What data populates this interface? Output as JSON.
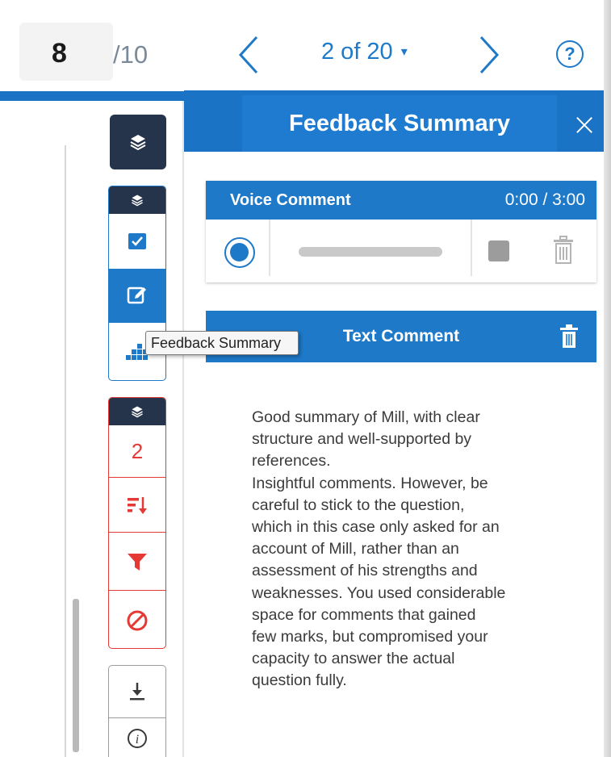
{
  "grade": {
    "score": "8",
    "max": "/10"
  },
  "navigation": {
    "prev_icon": "chevron-left-icon",
    "next_icon": "chevron-right-icon",
    "page_indicator": "2 of 20",
    "caret": "▾",
    "help_label": "?"
  },
  "toolbar": {
    "layers_icon": "layers-icon",
    "blue_group": [
      "layers-icon",
      "checkbox-icon",
      "edit-icon",
      "grid-icon"
    ],
    "red_group": {
      "count": "2",
      "icons": [
        "layers-icon",
        "sort-icon",
        "filter-icon",
        "block-icon"
      ]
    },
    "gray_group": [
      "download-icon",
      "info-icon"
    ],
    "info_label": "i"
  },
  "tooltip": {
    "text": "Feedback Summary"
  },
  "panel": {
    "title": "Feedback Summary",
    "close_label": "×",
    "voice_comment": {
      "label": "Voice Comment",
      "time": "0:00 / 3:00"
    },
    "text_comment": {
      "label": "Text Comment",
      "body": "Good summary of Mill, with clear\nstructure and well-supported by\nreferences.\nInsightful comments. However, be\ncareful to stick to the question,\nwhich in this case only asked for an\naccount of Mill, rather than an\nassessment of his strengths and\nweaknesses. You used considerable\nspace for comments that gained\nfew marks, but compromised your\ncapacity to answer the actual\nquestion fully."
    }
  },
  "colors": {
    "accent": "#1e79c8",
    "dark": "#25344a",
    "red": "#e53935"
  }
}
